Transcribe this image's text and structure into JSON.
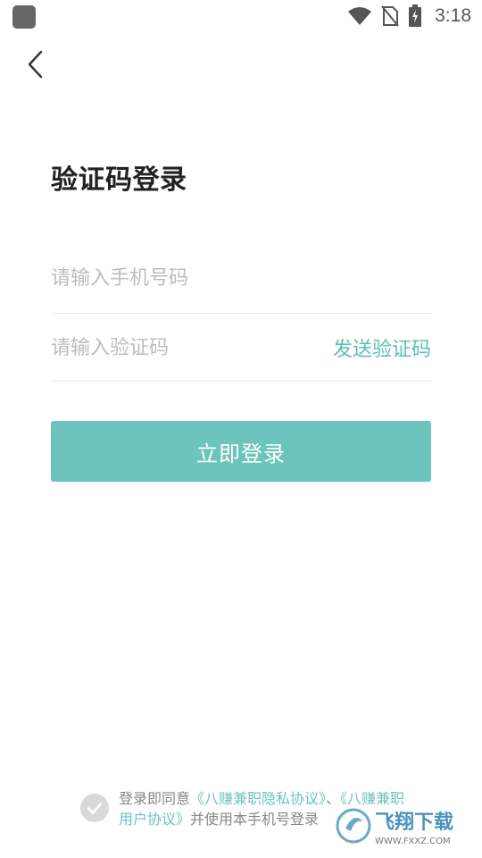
{
  "status_bar": {
    "time": "3:18",
    "icons": [
      "app-notification-icon",
      "wifi-icon",
      "no-sim-icon",
      "battery-charging-icon"
    ]
  },
  "header": {
    "back_icon": "chevron-left-icon"
  },
  "page": {
    "title": "验证码登录"
  },
  "form": {
    "phone_placeholder": "请输入手机号码",
    "phone_value": "",
    "code_placeholder": "请输入验证码",
    "code_value": "",
    "send_code_label": "发送验证码",
    "login_label": "立即登录"
  },
  "agreement": {
    "prefix": "登录即同意",
    "privacy_link": "《八赚兼职隐私协议》",
    "separator": "、",
    "user_link": "《八赚兼职用户协议》",
    "suffix": "并使用本手机号登录"
  },
  "watermark": {
    "logo_text": "飞翔下载",
    "url_text": "WWW.FXXZ.COM"
  },
  "colors": {
    "accent": "#6cc4bc",
    "link": "#5bbfb5",
    "title": "#222222",
    "placeholder": "#bdbdbd"
  }
}
